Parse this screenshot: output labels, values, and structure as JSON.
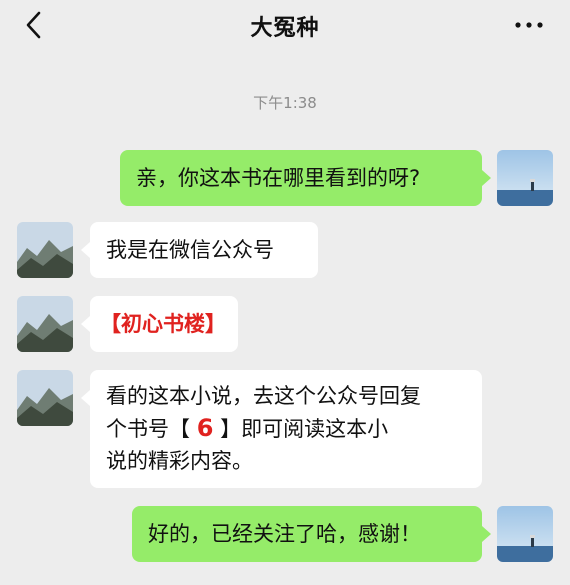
{
  "header": {
    "title": "大冤种"
  },
  "timestamp": "下午1:38",
  "messages": {
    "m1": "亲，你这本书在哪里看到的呀?",
    "m2": "我是在微信公众号",
    "m3": "【初心书楼】",
    "m4_line1": "看的这本小说，去这个公众号回复",
    "m4_line2_a": "个书号【 ",
    "m4_code": "6",
    "m4_line2_b": " 】即可阅读这本小",
    "m4_line3": "说的精彩内容。",
    "m5": "好的，已经关注了哈，感谢！"
  },
  "colors": {
    "background": "#ededed",
    "sent_bubble": "#95ec69",
    "received_bubble": "#ffffff",
    "highlight": "#e0221f"
  },
  "icons": [
    "back-icon",
    "more-icon",
    "avatar-sea",
    "avatar-mountain"
  ]
}
